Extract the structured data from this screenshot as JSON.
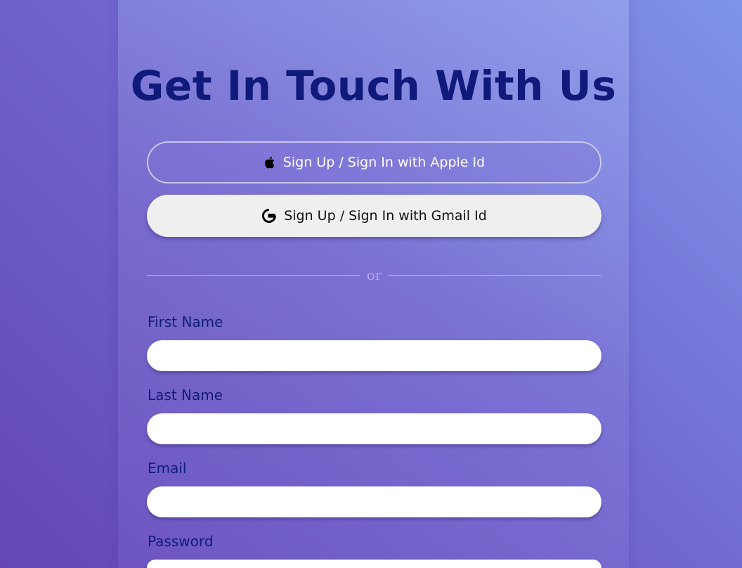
{
  "page": {
    "title": "Get In Touch With Us"
  },
  "auth": {
    "apple_label": "Sign Up / Sign In with Apple Id",
    "apple_icon": "apple-icon",
    "gmail_label": "Sign Up / Sign In with Gmail Id",
    "gmail_icon": "google-icon"
  },
  "divider": {
    "text": "or"
  },
  "form": {
    "fields": [
      {
        "label": "First Name",
        "value": "",
        "placeholder": ""
      },
      {
        "label": "Last Name",
        "value": "",
        "placeholder": ""
      },
      {
        "label": "Email",
        "value": "",
        "placeholder": ""
      },
      {
        "label": "Password",
        "value": "",
        "placeholder": ""
      }
    ]
  },
  "colors": {
    "title": "#101a7a",
    "label": "#0f1d78",
    "divider_text": "#b9a2f2",
    "gmail_button_bg": "#efefef"
  }
}
